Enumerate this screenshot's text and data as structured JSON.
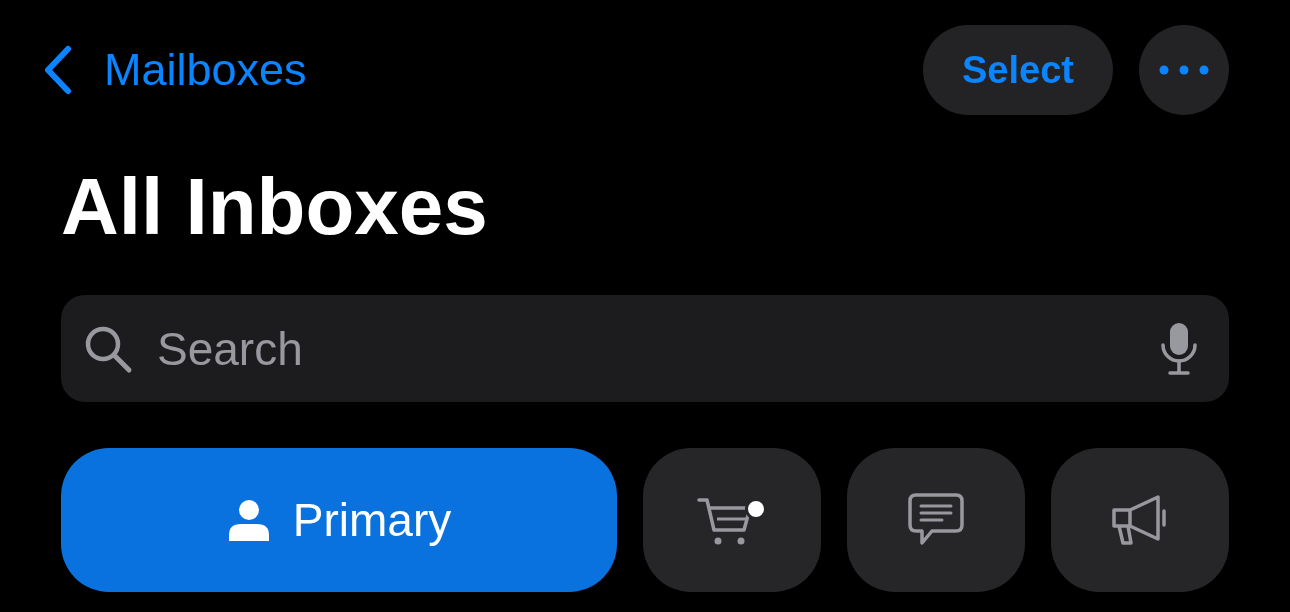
{
  "nav": {
    "back_label": "Mailboxes",
    "action": "Select"
  },
  "title": "All Inboxes",
  "search": {
    "placeholder": "Search"
  },
  "categories": [
    {
      "kind": "primary",
      "label": "Primary",
      "selected": true,
      "unread": false
    },
    {
      "kind": "transactions",
      "selected": false,
      "unread": true
    },
    {
      "kind": "updates",
      "selected": false,
      "unread": false
    },
    {
      "kind": "promotions",
      "selected": false,
      "unread": false
    }
  ]
}
